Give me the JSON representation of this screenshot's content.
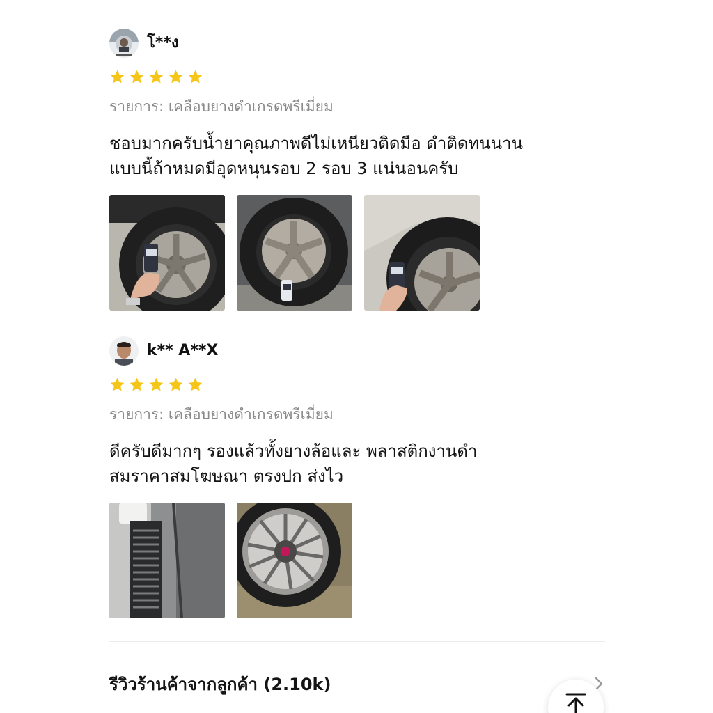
{
  "reviews": [
    {
      "reviewer": "โ**ง",
      "rating": 5,
      "item_label": "รายการ: เคลือบยางดำเกรดพรีเมี่ยม",
      "comment_lines": [
        "ชอบมากครับน้ำยาคุณภาพดีไม่เหนียวติดมือ ดำติดทนนาน",
        "แบบนี้ถ้าหมดมีอุดหนุนรอบ 2 รอบ 3 แน่นอนครับ"
      ],
      "photo_count": 3
    },
    {
      "reviewer": "k** A**X",
      "rating": 5,
      "item_label": "รายการ: เคลือบยางดำเกรดพรีเมี่ยม",
      "comment_lines": [
        "ดีครับดีมากๆ รองแล้วทั้งยางล้อและ พลาสติกงานดำ",
        "สมราคาสมโฆษณา ตรงปก ส่งไว"
      ],
      "photo_count": 2
    }
  ],
  "shop_reviews": {
    "title": "รีวิวร้านค้าจากลูกค้า (2.10k)"
  },
  "icons": {
    "star": "star-icon",
    "chevron": "chevron-right-icon",
    "back_to_top": "back-to-top-icon"
  },
  "colors": {
    "star": "#f5c518",
    "muted_text": "#8a8a8a",
    "divider": "#ebebeb"
  }
}
